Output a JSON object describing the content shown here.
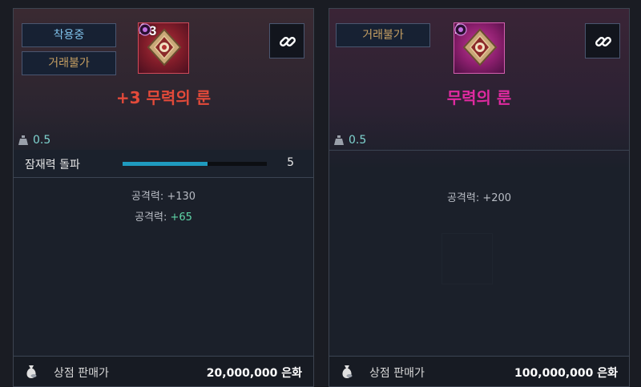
{
  "left": {
    "tags": [
      "착용중",
      "거래불가"
    ],
    "enhance": "+3",
    "title": "+3 무력의 룬",
    "weight": "0.5",
    "potential": {
      "label": "잠재력 돌파",
      "value": "5",
      "fill_fraction": 0.59
    },
    "stats": [
      {
        "prefix": "공격력: ",
        "value": "+130",
        "bonus": false
      },
      {
        "prefix": "공격력: ",
        "value": "+65",
        "bonus": true
      }
    ],
    "shop_label": "상점 판매가",
    "shop_price": "20,000,000 은화"
  },
  "right": {
    "tags": [
      "거래불가"
    ],
    "title": "무력의 룬",
    "weight": "0.5",
    "stats": [
      {
        "prefix": "공격력: ",
        "value": "+200",
        "bonus": false
      }
    ],
    "shop_label": "상점 판매가",
    "shop_price": "100,000,000 은화"
  },
  "icons": {
    "link": "link-icon",
    "weight": "weight-icon",
    "bag": "money-bag-icon",
    "lock": "lock-icon",
    "gem": "gem-icon",
    "rune": "rune-icon"
  },
  "colors": {
    "title_left": "#e34a3a",
    "title_right": "#e02aa0",
    "tag_text": "#c7a063",
    "equipped_text": "#7fc0e8",
    "bonus_stat": "#5fd6a8",
    "potential_bar": "#1f9bbf"
  }
}
